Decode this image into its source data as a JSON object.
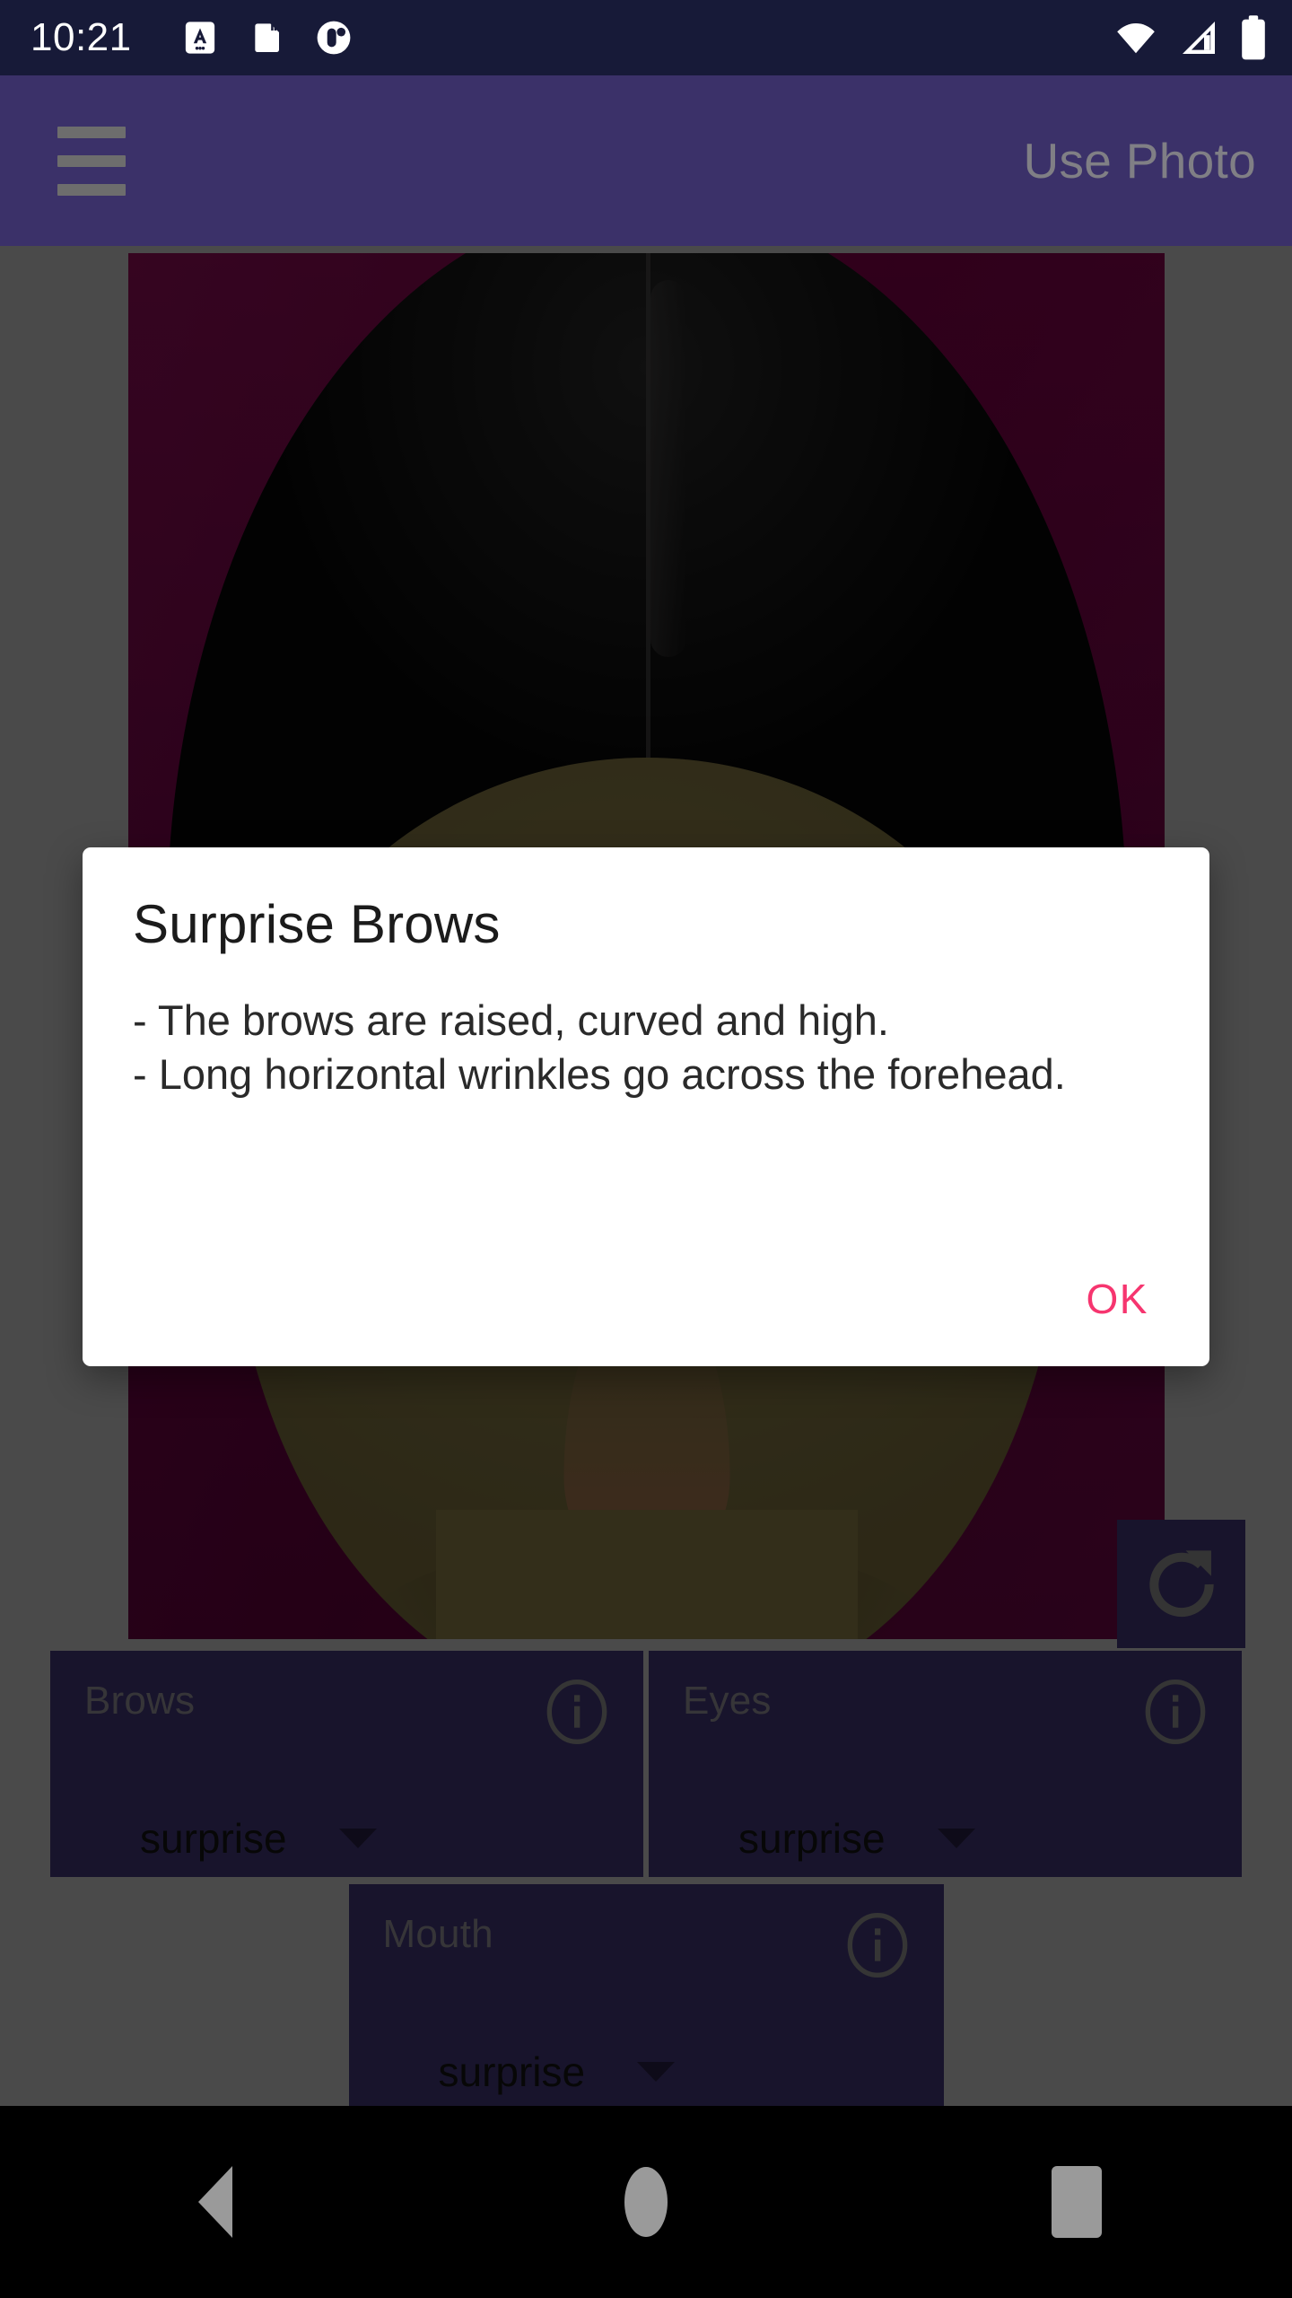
{
  "status_bar": {
    "time": "10:21",
    "icons": [
      "text-format-icon",
      "sd-card-icon",
      "app-badge-icon"
    ],
    "right_icons": [
      "wifi-icon",
      "cellular-signal-icon",
      "battery-icon"
    ]
  },
  "app_bar": {
    "menu_icon": "hamburger-menu-icon",
    "title": "Use Photo"
  },
  "photo": {
    "rotate_icon": "rotate-refresh-icon",
    "background_color": "#6c0040",
    "hair_color": "#0a0a0a",
    "skin_color": "#756a3c",
    "mouth_color": "#3a0b0c"
  },
  "controls": [
    {
      "title": "Brows",
      "info_icon": "info-circle-icon",
      "value": "surprise",
      "caret_icon": "chevron-down-icon"
    },
    {
      "title": "Eyes",
      "info_icon": "info-circle-icon",
      "value": "surprise",
      "caret_icon": "chevron-down-icon"
    },
    {
      "title": "Mouth",
      "info_icon": "info-circle-icon",
      "value": "surprise",
      "caret_icon": "chevron-down-icon"
    }
  ],
  "dialog": {
    "title": "Surprise Brows",
    "message": "- The brows are raised, curved and high.\n- Long horizontal wrinkles go across the forehead.",
    "ok_label": "OK",
    "ok_color": "#f6356f"
  },
  "nav_bar": {
    "back": "back-triangle-icon",
    "home": "home-circle-icon",
    "recents": "recents-square-icon"
  }
}
